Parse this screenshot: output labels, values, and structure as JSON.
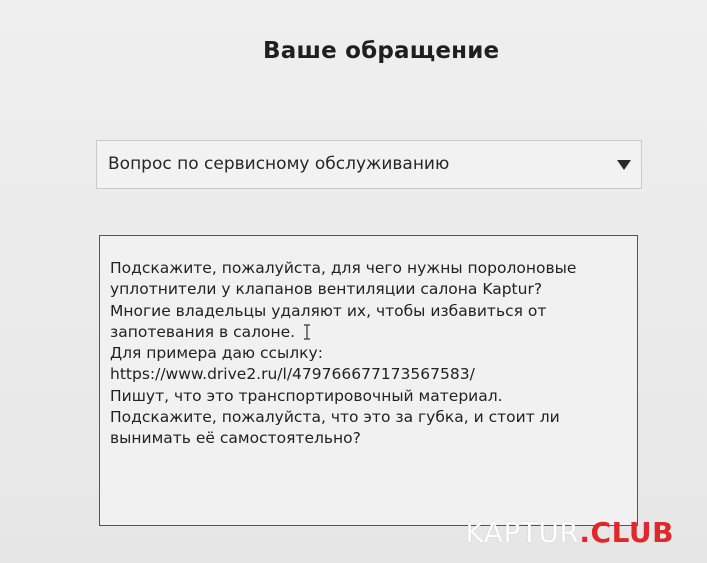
{
  "page": {
    "title": "Ваше обращение"
  },
  "topic_select": {
    "selected": "Вопрос по сервисному обслуживанию",
    "icon": "chevron-down-icon"
  },
  "message_field": {
    "lines": [
      "Подскажите, пожалуйста, для чего нужны поролоновые",
      "уплотнители у клапанов вентиляции салона Kaptur?",
      "Многие владельцы удаляют их, чтобы избавиться от",
      "запотевания в салоне.",
      "Для примера даю ссылку:",
      "https://www.drive2.ru/l/479766677173567583/",
      "Пишут, что это транспортировочный материал.",
      "Подскажите, пожалуйста, что это за губка, и стоит ли",
      "вынимать её самостоятельно?"
    ]
  },
  "watermark": {
    "brand": "KAPTUR",
    "suffix": ".CLUB",
    "colors": {
      "brand": "#ffffff",
      "suffix": "#e0282b"
    }
  }
}
